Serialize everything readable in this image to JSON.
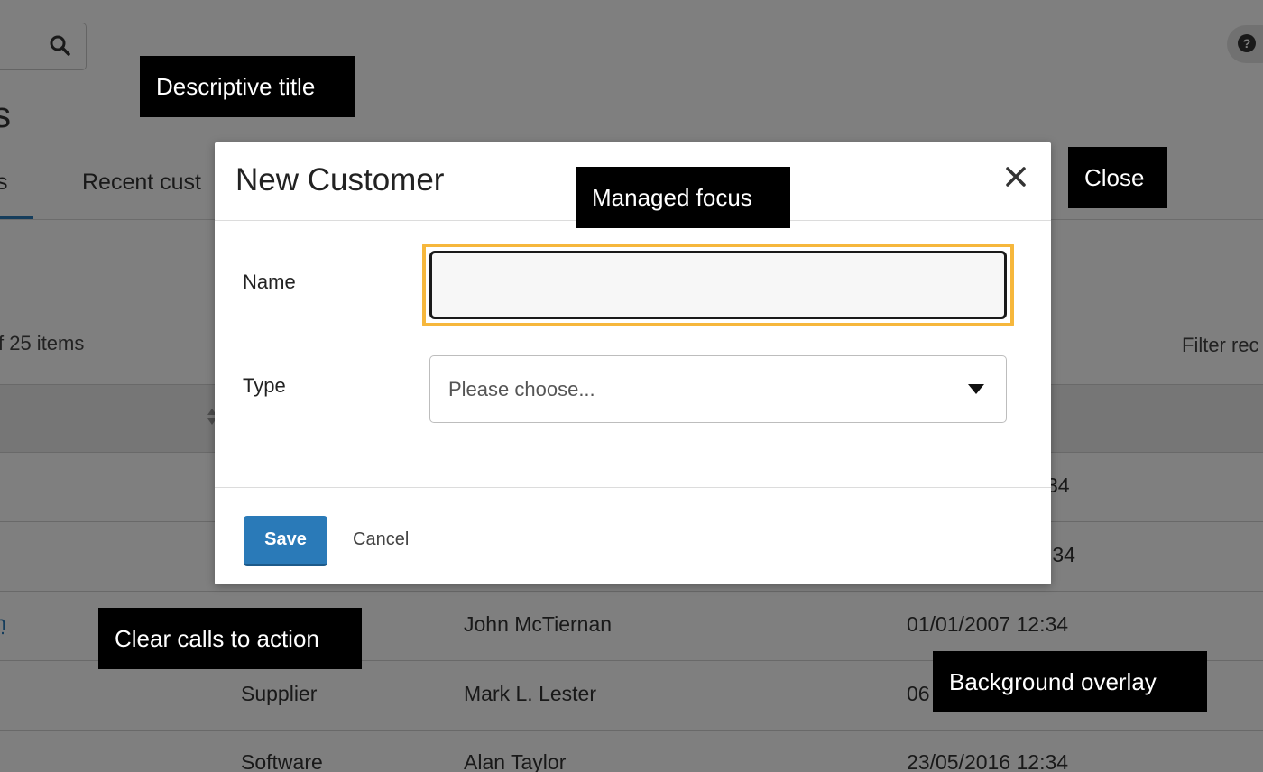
{
  "background": {
    "page_title": "s",
    "tabs": [
      {
        "label": "s"
      },
      {
        "label": "Recent cust"
      }
    ],
    "count_text": "f 25 items",
    "filter_text": "Filter rec",
    "rows": [
      {
        "col1": "",
        "col2": "",
        "col3": "",
        "col4": "34"
      },
      {
        "col1": "",
        "col2": "",
        "col3": "",
        "col4": ":34"
      },
      {
        "col1": "n",
        "col2": "",
        "col3": "John McTiernan",
        "col4": "01/01/2007 12:34"
      },
      {
        "col1": "",
        "col2": "Supplier",
        "col3": "Mark L. Lester",
        "col4": "06"
      },
      {
        "col1": "",
        "col2": "Software",
        "col3": "Alan Taylor",
        "col4": "23/05/2016 12:34"
      }
    ],
    "icons": {
      "search": "search-icon",
      "help": "help-icon",
      "sort": "sort-icon"
    }
  },
  "modal": {
    "title": "New Customer",
    "close_icon": "close-icon",
    "fields": [
      {
        "label": "Name",
        "value": ""
      },
      {
        "label": "Type",
        "placeholder": "Please choose..."
      }
    ],
    "save_label": "Save",
    "cancel_label": "Cancel",
    "focus_color": "#f6b73c",
    "primary_color": "#2a7ab8"
  },
  "annotations": [
    {
      "label": "Descriptive title"
    },
    {
      "label": "Managed focus"
    },
    {
      "label": "Close"
    },
    {
      "label": "Clear calls to action"
    },
    {
      "label": "Background overlay"
    }
  ]
}
